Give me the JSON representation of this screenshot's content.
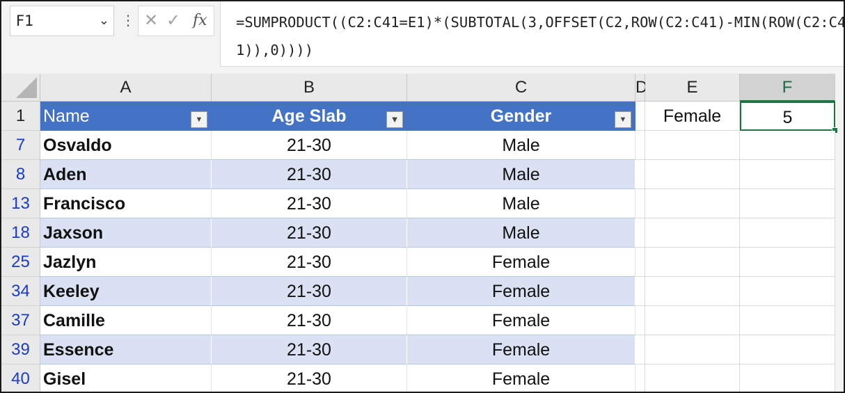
{
  "formula_bar": {
    "name_box": "F1",
    "formula": "=SUMPRODUCT((C2:C41=E1)*(SUBTOTAL(3,OFFSET(C2,ROW(C2:C41)-MIN(ROW(C2:C41)),0))))"
  },
  "icons": {
    "name_box_dropdown": "chevron-down",
    "more": "vertical-ellipsis",
    "cancel": "x-mark",
    "enter": "check-mark",
    "insert_function": "fx"
  },
  "columns": [
    "A",
    "B",
    "C",
    "D",
    "E",
    "F"
  ],
  "selected_column": "F",
  "table": {
    "header_row_number": "1",
    "headers": [
      "Name",
      "Age Slab",
      "Gender"
    ],
    "filter_active_column": "Age Slab",
    "rows": [
      {
        "row": "7",
        "name": "Osvaldo",
        "age": "21-30",
        "gender": "Male"
      },
      {
        "row": "8",
        "name": "Aden",
        "age": "21-30",
        "gender": "Male"
      },
      {
        "row": "13",
        "name": "Francisco",
        "age": "21-30",
        "gender": "Male"
      },
      {
        "row": "18",
        "name": "Jaxson",
        "age": "21-30",
        "gender": "Male"
      },
      {
        "row": "25",
        "name": "Jazlyn",
        "age": "21-30",
        "gender": "Female"
      },
      {
        "row": "34",
        "name": "Keeley",
        "age": "21-30",
        "gender": "Female"
      },
      {
        "row": "37",
        "name": "Camille",
        "age": "21-30",
        "gender": "Female"
      },
      {
        "row": "39",
        "name": "Essence",
        "age": "21-30",
        "gender": "Female"
      },
      {
        "row": "40",
        "name": "Gisel",
        "age": "21-30",
        "gender": "Female"
      }
    ]
  },
  "criteria": {
    "label": "Female",
    "result": "5"
  },
  "colors": {
    "table_header": "#4472c4",
    "band": "#d9e1f2",
    "row_number": "#1a3cc4",
    "selection": "#217346"
  }
}
